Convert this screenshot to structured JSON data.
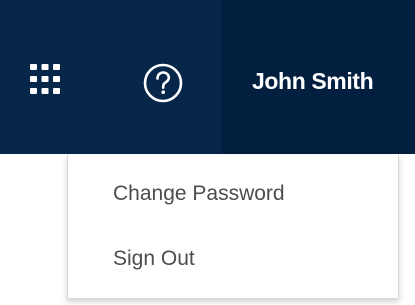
{
  "header": {
    "apps_icon": "grid-icon",
    "help_icon": "question-mark-circle-icon",
    "user_name": "John Smith"
  },
  "user_menu": {
    "items": [
      {
        "label": "Change Password"
      },
      {
        "label": "Sign Out"
      }
    ]
  },
  "colors": {
    "header_background": "#06264a",
    "user_area_background": "#031f3f",
    "header_text": "#ffffff",
    "menu_text": "#4d4d4d",
    "menu_background": "#ffffff"
  }
}
